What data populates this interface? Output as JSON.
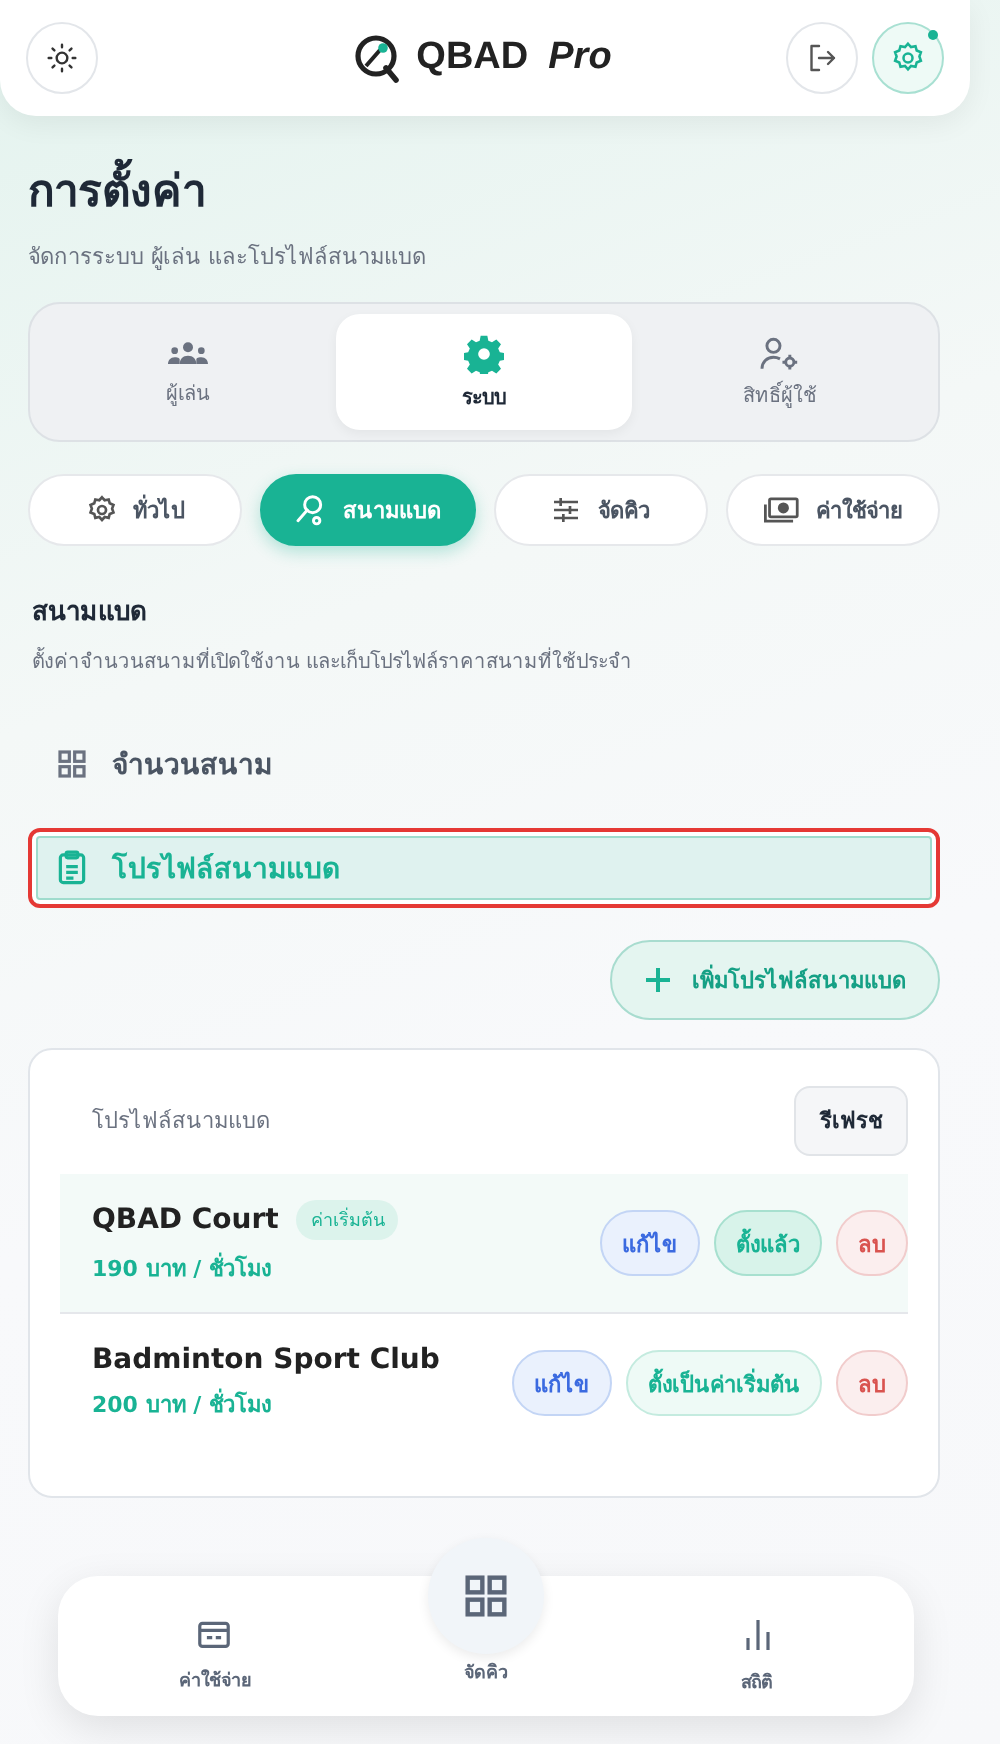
{
  "header": {
    "logo_text": "QBAD",
    "logo_suffix": "Pro",
    "notification_dot": true
  },
  "page": {
    "title": "การตั้งค่า",
    "subtitle": "จัดการระบบ ผู้เล่น และโปรไฟล์สนามแบด"
  },
  "main_tabs": [
    {
      "label": "ผู้เล่น",
      "selected": false
    },
    {
      "label": "ระบบ",
      "selected": true
    },
    {
      "label": "สิทธิ์ผู้ใช้",
      "selected": false
    }
  ],
  "sub_tabs": [
    {
      "label": "ทั่วไป",
      "selected": false
    },
    {
      "label": "สนามแบด",
      "selected": true
    },
    {
      "label": "จัดคิว",
      "selected": false
    },
    {
      "label": "ค่าใช้จ่าย",
      "selected": false
    }
  ],
  "section": {
    "title": "สนามแบด",
    "description": "ตั้งค่าจำนวนสนามที่เปิดใช้งาน และเก็บโปรไฟล์ราคาสนามที่ใช้ประจำ"
  },
  "menu_items": [
    {
      "label": "จำนวนสนาม",
      "selected": false
    },
    {
      "label": "โปรไฟล์สนามแบด",
      "selected": true
    }
  ],
  "add_button": {
    "label": "เพิ่มโปรไฟล์สนามแบด"
  },
  "profiles_card": {
    "title": "โปรไฟล์สนามแบด",
    "refresh": "รีเฟรช",
    "profiles": [
      {
        "name": "QBAD Court",
        "price": "190 บาท / ชั่วโมง",
        "is_default": true,
        "default_badge": "ค่าเริ่มต้น",
        "edit": "แก้ไข",
        "default_action": "ตั้งแล้ว",
        "delete": "ลบ"
      },
      {
        "name": "Badminton Sport Club",
        "price": "200 บาท / ชั่วโมง",
        "is_default": false,
        "edit": "แก้ไข",
        "default_action": "ตั้งเป็นค่าเริ่มต้น",
        "delete": "ลบ"
      }
    ]
  },
  "bottom_nav": [
    {
      "label": "ค่าใช้จ่าย",
      "kind": "side"
    },
    {
      "label": "จัดคิว",
      "kind": "center"
    },
    {
      "label": "สถิติ",
      "kind": "side"
    }
  ]
}
